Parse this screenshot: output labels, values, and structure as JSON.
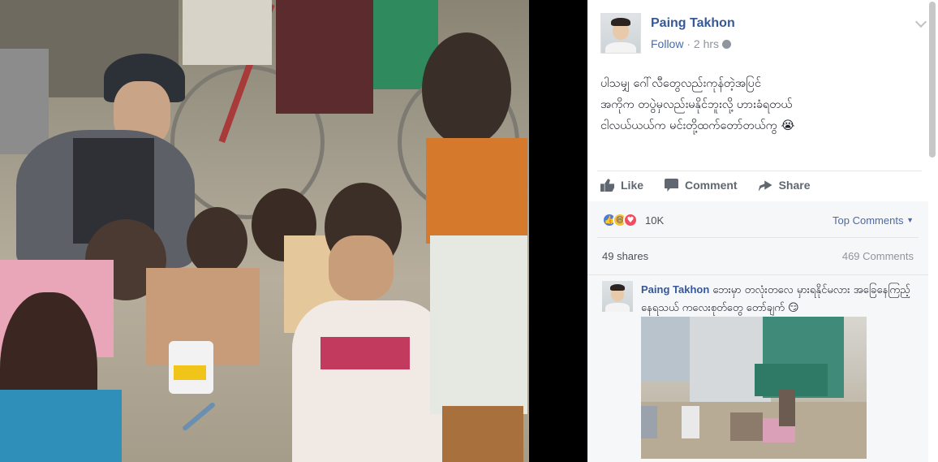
{
  "post": {
    "author": "Paing Takhon",
    "follow_label": "Follow",
    "separator": " · ",
    "time": "2 hrs",
    "text_lines": [
      "ပါသမျှ ဂေါ်လီတွေလည်းကုန်တဲ့အပြင်",
      "အကိုက တပွဲမှလည်းမနိုင်ဘူးလို့ ဟားခံရတယ်",
      "ငါလယ်ယယ်က မင်းတို့ထက်တော်တယ်ကွ 😭"
    ]
  },
  "actions": {
    "like": "Like",
    "comment": "Comment",
    "share": "Share"
  },
  "stats": {
    "reaction_count": "10K",
    "reaction_icons": [
      "like-icon",
      "haha-icon",
      "love-icon"
    ],
    "top_comments_label": "Top Comments",
    "shares": "49 shares",
    "comments": "469 Comments"
  },
  "comment": {
    "author": "Paing Takhon",
    "text": "ဘေးမှာ တလုံးတလေ မှားရနိုင်မလား အခြေနေကြည့်နေရသယ် ကလေးစုတ်တွေ တော်ချက် 😏"
  },
  "colors": {
    "name_blue": "#365899",
    "link_blue": "#4b6aa6",
    "muted": "#90949c",
    "panel_bg": "#ffffff",
    "stats_bg": "#f6f7f9"
  }
}
